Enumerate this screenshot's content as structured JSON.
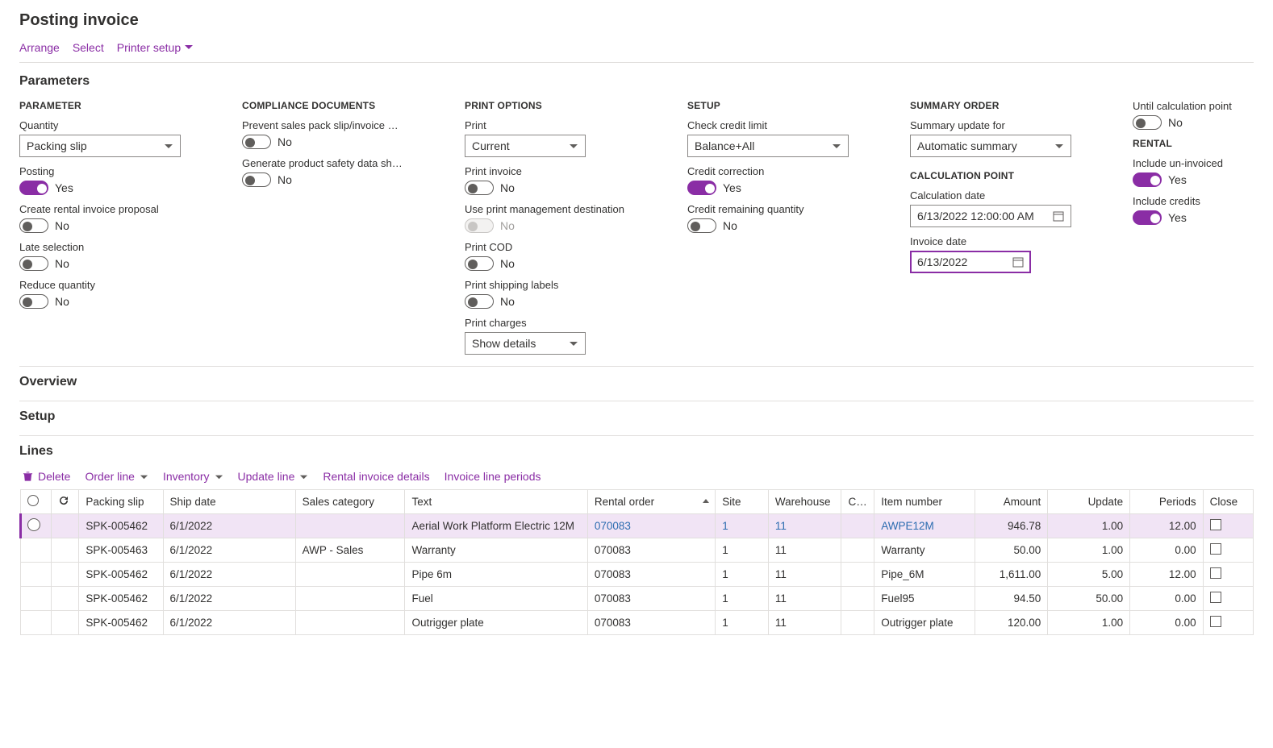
{
  "page_title": "Posting invoice",
  "toolbar": {
    "arrange": "Arrange",
    "select": "Select",
    "printer_setup": "Printer setup"
  },
  "sections": {
    "parameters": "Parameters",
    "overview": "Overview",
    "setup": "Setup",
    "lines": "Lines"
  },
  "param": {
    "col_parameter": "PARAMETER",
    "quantity_label": "Quantity",
    "quantity_value": "Packing slip",
    "posting_label": "Posting",
    "posting_state": "Yes",
    "create_rental_label": "Create rental invoice proposal",
    "create_rental_state": "No",
    "late_sel_label": "Late selection",
    "late_sel_state": "No",
    "reduce_qty_label": "Reduce quantity",
    "reduce_qty_state": "No"
  },
  "compliance": {
    "col": "COMPLIANCE DOCUMENTS",
    "prevent_label": "Prevent sales pack slip/invoice posti...",
    "prevent_state": "No",
    "generate_label": "Generate product safety data sheet",
    "generate_state": "No"
  },
  "print": {
    "col": "PRINT OPTIONS",
    "print_label": "Print",
    "print_value": "Current",
    "print_invoice_label": "Print invoice",
    "print_invoice_state": "No",
    "use_pm_label": "Use print management destination",
    "use_pm_state": "No",
    "print_cod_label": "Print COD",
    "print_cod_state": "No",
    "print_ship_label": "Print shipping labels",
    "print_ship_state": "No",
    "print_charges_label": "Print charges",
    "print_charges_value": "Show details"
  },
  "setup": {
    "col": "SETUP",
    "check_credit_label": "Check credit limit",
    "check_credit_value": "Balance+All",
    "credit_corr_label": "Credit correction",
    "credit_corr_state": "Yes",
    "credit_rem_label": "Credit remaining quantity",
    "credit_rem_state": "No"
  },
  "summary": {
    "col": "SUMMARY ORDER",
    "sum_update_label": "Summary update for",
    "sum_update_value": "Automatic summary",
    "calc_head": "CALCULATION POINT",
    "calc_date_label": "Calculation date",
    "calc_date_value": "6/13/2022 12:00:00 AM",
    "inv_date_label": "Invoice date",
    "inv_date_value": "6/13/2022"
  },
  "rental": {
    "until_label": "Until calculation point",
    "until_state": "No",
    "rental_head": "RENTAL",
    "inc_un_label": "Include un-invoiced",
    "inc_un_state": "Yes",
    "inc_cr_label": "Include credits",
    "inc_cr_state": "Yes"
  },
  "lines_toolbar": {
    "delete": "Delete",
    "order_line": "Order line",
    "inventory": "Inventory",
    "update_line": "Update line",
    "rental_inv": "Rental invoice details",
    "inv_line_per": "Invoice line periods"
  },
  "grid": {
    "headers": {
      "packing_slip": "Packing slip",
      "ship_date": "Ship date",
      "sales_category": "Sales category",
      "text": "Text",
      "rental_order": "Rental order",
      "site": "Site",
      "warehouse": "Warehouse",
      "cw": "CW...",
      "item_number": "Item number",
      "amount": "Amount",
      "update": "Update",
      "periods": "Periods",
      "close": "Close"
    },
    "rows": [
      {
        "selected": true,
        "link": true,
        "packing_slip": "SPK-005462",
        "ship_date": "6/1/2022",
        "sales_category": "",
        "text": "Aerial Work Platform Electric 12M",
        "rental_order": "070083",
        "site": "1",
        "warehouse": "11",
        "cw": "",
        "item_number": "AWPE12M",
        "amount": "946.78",
        "update": "1.00",
        "periods": "12.00"
      },
      {
        "selected": false,
        "link": false,
        "packing_slip": "SPK-005463",
        "ship_date": "6/1/2022",
        "sales_category": "AWP - Sales",
        "text": "Warranty",
        "rental_order": "070083",
        "site": "1",
        "warehouse": "11",
        "cw": "",
        "item_number": "Warranty",
        "amount": "50.00",
        "update": "1.00",
        "periods": "0.00"
      },
      {
        "selected": false,
        "link": false,
        "packing_slip": "SPK-005462",
        "ship_date": "6/1/2022",
        "sales_category": "",
        "text": "Pipe 6m",
        "rental_order": "070083",
        "site": "1",
        "warehouse": "11",
        "cw": "",
        "item_number": "Pipe_6M",
        "amount": "1,611.00",
        "update": "5.00",
        "periods": "12.00"
      },
      {
        "selected": false,
        "link": false,
        "packing_slip": "SPK-005462",
        "ship_date": "6/1/2022",
        "sales_category": "",
        "text": "Fuel",
        "rental_order": "070083",
        "site": "1",
        "warehouse": "11",
        "cw": "",
        "item_number": "Fuel95",
        "amount": "94.50",
        "update": "50.00",
        "periods": "0.00"
      },
      {
        "selected": false,
        "link": false,
        "packing_slip": "SPK-005462",
        "ship_date": "6/1/2022",
        "sales_category": "",
        "text": "Outrigger plate",
        "rental_order": "070083",
        "site": "1",
        "warehouse": "11",
        "cw": "",
        "item_number": "Outrigger plate",
        "amount": "120.00",
        "update": "1.00",
        "periods": "0.00"
      }
    ]
  }
}
